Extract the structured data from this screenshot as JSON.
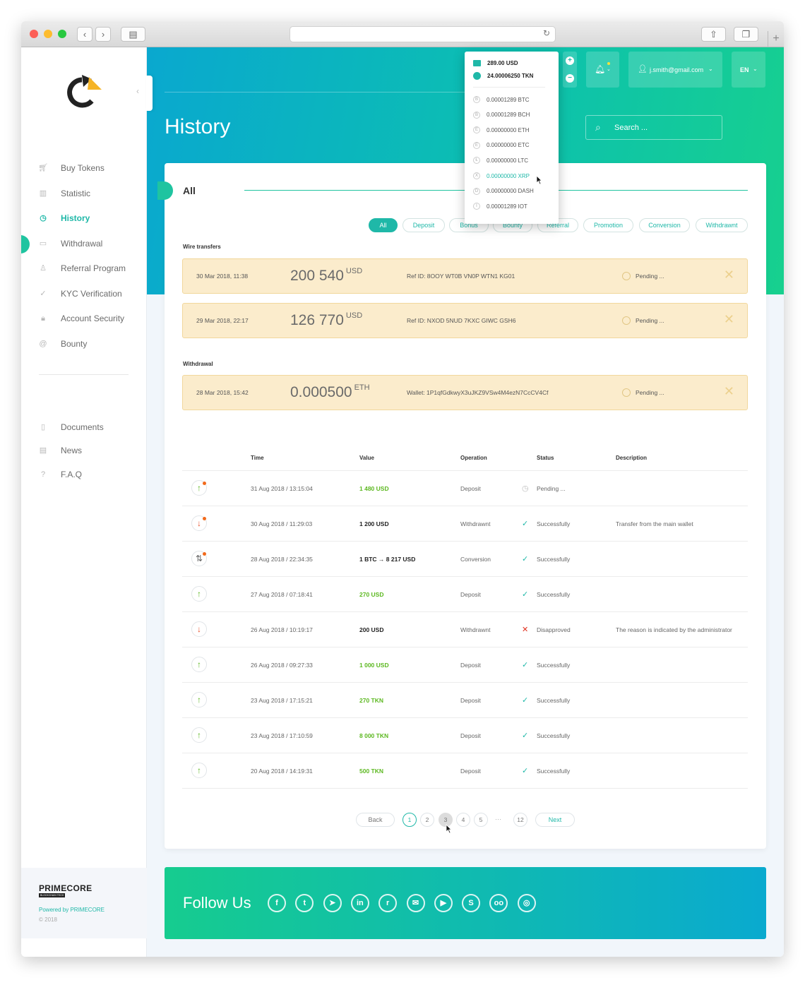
{
  "sidebar": {
    "items": [
      {
        "label": "Buy Tokens",
        "icon": "cart-icon"
      },
      {
        "label": "Statistic",
        "icon": "chart-icon"
      },
      {
        "label": "History",
        "icon": "clock-icon"
      },
      {
        "label": "Withdrawal",
        "icon": "wallet-icon"
      },
      {
        "label": "Referral Program",
        "icon": "user-icon"
      },
      {
        "label": "KYC Verification",
        "icon": "check-icon"
      },
      {
        "label": "Account Security",
        "icon": "lock-icon"
      },
      {
        "label": "Bounty",
        "icon": "at-icon"
      }
    ],
    "secondary": [
      {
        "label": "Documents",
        "icon": "document-icon"
      },
      {
        "label": "News",
        "icon": "news-icon"
      },
      {
        "label": "F.A.Q",
        "icon": "question-icon"
      }
    ],
    "brand": "PRIMECORE",
    "brand_sub": "BLOCKCHAIN TECH",
    "powered": "Powered by PRIMECORE",
    "copyright": "© 2018"
  },
  "header": {
    "page_title": "History",
    "search_placeholder": "Search ...",
    "user_email": "j.smith@gmail.com",
    "language": "EN"
  },
  "balances": {
    "usd": "289.00 USD",
    "tkn": "24.00006250 TKN",
    "coins": [
      {
        "value": "0.00001289 BTC",
        "symbol": "B"
      },
      {
        "value": "0.00001289 BCH",
        "symbol": "B"
      },
      {
        "value": "0.00000000 ETH",
        "symbol": "E"
      },
      {
        "value": "0.00000000 ETC",
        "symbol": "E"
      },
      {
        "value": "0.00000000 LTC",
        "symbol": "Ł"
      },
      {
        "value": "0.00000000 XRP",
        "symbol": "X"
      },
      {
        "value": "0.00000000 DASH",
        "symbol": "D"
      },
      {
        "value": "0.00001289 IOT",
        "symbol": "I"
      }
    ]
  },
  "tabs": {
    "title": "All",
    "filters": [
      "All",
      "Deposit",
      "Bonus",
      "Bounty",
      "Referral",
      "Promotion",
      "Conversion",
      "Withdrawnt"
    ]
  },
  "wire_transfers": {
    "heading": "Wire transfers",
    "items": [
      {
        "date": "30 Mar 2018, 11:38",
        "amount": "200 540",
        "currency": "USD",
        "ref": "Ref ID: 8OOY WT0B VN0P WTN1 KG01",
        "status": "Pending ..."
      },
      {
        "date": "29 Mar 2018, 22:17",
        "amount": "126 770",
        "currency": "USD",
        "ref": "Ref ID: NXOD 5NUD 7KXC GIWC GSH6",
        "status": "Pending ..."
      }
    ]
  },
  "withdrawal": {
    "heading": "Withdrawal",
    "items": [
      {
        "date": "28 Mar 2018, 15:42",
        "amount": "0.000500",
        "currency": "ETH",
        "ref": "Wallet: 1P1qfGdkwyX3uJKZ9VSw4M4ezN7CcCV4Cf",
        "status": "Pending ..."
      }
    ]
  },
  "table": {
    "headers": [
      "Time",
      "Value",
      "Operation",
      "Status",
      "Description"
    ],
    "rows": [
      {
        "dir": "↑",
        "time": "31 Aug 2018 / 13:15:04",
        "value": "1 480 USD",
        "op": "Deposit",
        "status": "Pending ...",
        "desc": "",
        "kind": "pending",
        "badge": true
      },
      {
        "dir": "↓",
        "time": "30 Aug 2018 / 11:29:03",
        "value": "1 200 USD",
        "op": "Withdrawnt",
        "status": "Successfully",
        "desc": "Transfer from the main wallet",
        "kind": "ok",
        "badge": true
      },
      {
        "dir": "⇅",
        "time": "28 Aug 2018 / 22:34:35",
        "value": "1 BTC → 8 217 USD",
        "op": "Conversion",
        "status": "Successfully",
        "desc": "",
        "kind": "ok",
        "badge": true
      },
      {
        "dir": "↑",
        "time": "27 Aug 2018 / 07:18:41",
        "value": "270 USD",
        "op": "Deposit",
        "status": "Successfully",
        "desc": "",
        "kind": "ok",
        "badge": false
      },
      {
        "dir": "↓",
        "time": "26 Aug 2018 / 10:19:17",
        "value": "200 USD",
        "op": "Withdrawnt",
        "status": "Disapproved",
        "desc": "The reason is indicated by the administrator",
        "kind": "fail",
        "badge": false
      },
      {
        "dir": "↑",
        "time": "26 Aug 2018 / 09:27:33",
        "value": "1 000 USD",
        "op": "Deposit",
        "status": "Successfully",
        "desc": "",
        "kind": "ok",
        "badge": false
      },
      {
        "dir": "↑",
        "time": "23 Aug 2018 / 17:15:21",
        "value": "270 TKN",
        "op": "Deposit",
        "status": "Successfully",
        "desc": "",
        "kind": "ok",
        "badge": false
      },
      {
        "dir": "↑",
        "time": "23 Aug 2018 / 17:10:59",
        "value": "8 000 TKN",
        "op": "Deposit",
        "status": "Successfully",
        "desc": "",
        "kind": "ok",
        "badge": false
      },
      {
        "dir": "↑",
        "time": "20 Aug 2018 / 14:19:31",
        "value": "500 TKN",
        "op": "Deposit",
        "status": "Successfully",
        "desc": "",
        "kind": "ok",
        "badge": false
      }
    ]
  },
  "pagination": {
    "back": "Back",
    "next": "Next",
    "pages": [
      "1",
      "2",
      "3",
      "4",
      "5"
    ],
    "ellipsis": "···",
    "last": "12",
    "current": "3"
  },
  "follow": {
    "title": "Follow Us",
    "networks": [
      {
        "name": "facebook-icon",
        "glyph": "f"
      },
      {
        "name": "twitter-icon",
        "glyph": "t"
      },
      {
        "name": "telegram-icon",
        "glyph": "➤"
      },
      {
        "name": "linkedin-icon",
        "glyph": "in"
      },
      {
        "name": "reddit-icon",
        "glyph": "r"
      },
      {
        "name": "mail-icon",
        "glyph": "✉"
      },
      {
        "name": "youtube-icon",
        "glyph": "▶"
      },
      {
        "name": "skype-icon",
        "glyph": "S"
      },
      {
        "name": "flickr-icon",
        "glyph": "oo"
      },
      {
        "name": "instagram-icon",
        "glyph": "◎"
      }
    ]
  },
  "colors": {
    "accent": "#1fb8a8",
    "deposit": "#5cb820",
    "withdraw": "#e8502a",
    "pending_bg": "#fbeccc",
    "hero_start": "#0aa8cf",
    "hero_end": "#17d08e"
  }
}
